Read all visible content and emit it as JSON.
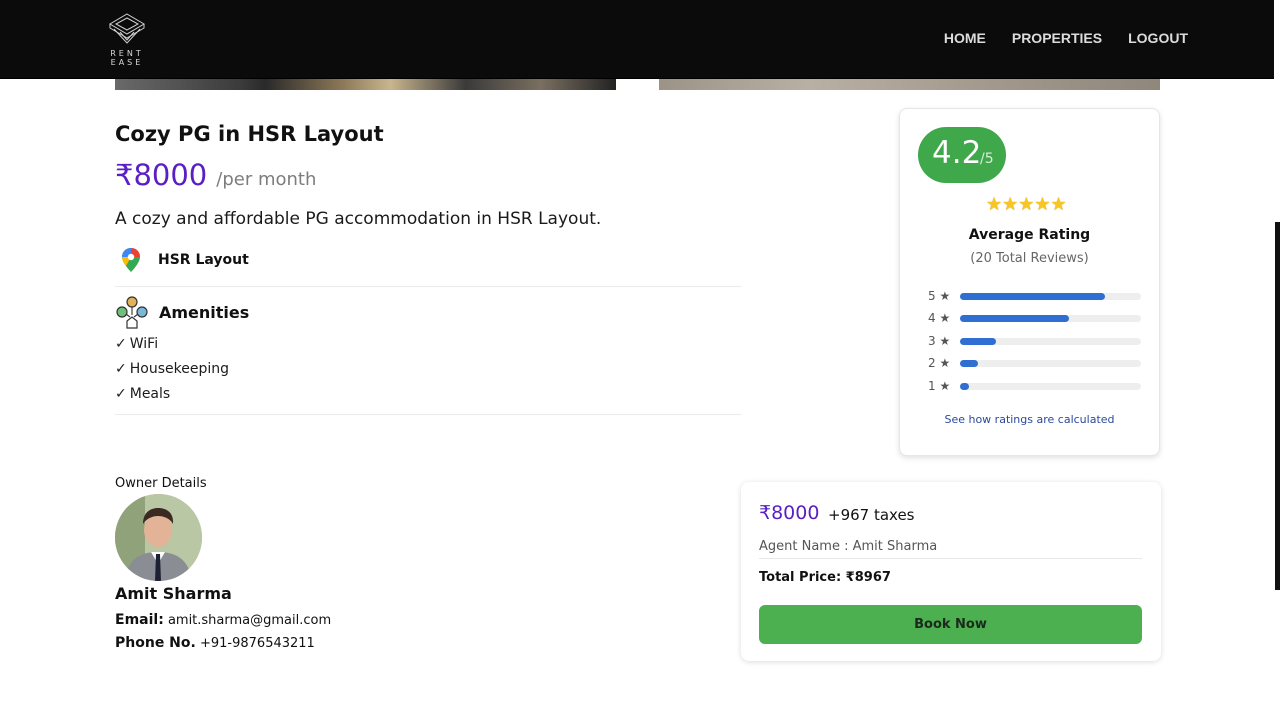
{
  "header": {
    "logo_text": "RENT EASE",
    "nav": [
      "HOME",
      "PROPERTIES",
      "LOGOUT"
    ]
  },
  "listing": {
    "title": "Cozy PG in HSR Layout",
    "price": "₹8000",
    "price_unit": "/per month",
    "description": "A cozy and affordable PG accommodation in HSR Layout.",
    "location": "HSR Layout",
    "amenities_title": "Amenities",
    "amenities": [
      "WiFi",
      "Housekeeping",
      "Meals"
    ],
    "check_mark": "✓"
  },
  "rating": {
    "value": "4.2",
    "max": "/5",
    "stars": "★★★★★",
    "stars_count": 5,
    "label": "Average Rating",
    "total_reviews": "(20 Total Reviews)",
    "breakdown": [
      {
        "label": "5 ★",
        "fraction": 0.8
      },
      {
        "label": "4 ★",
        "fraction": 0.6
      },
      {
        "label": "3 ★",
        "fraction": 0.2
      },
      {
        "label": "2 ★",
        "fraction": 0.1
      },
      {
        "label": "1 ★",
        "fraction": 0.05
      }
    ],
    "link_text": "See how ratings are calculated",
    "pill_color": "#3fa84a",
    "bar_color": "#2f6fd1"
  },
  "owner": {
    "section_label": "Owner Details",
    "name": "Amit Sharma",
    "email_label": "Email:",
    "email": "amit.sharma@gmail.com",
    "phone_label": "Phone No.",
    "phone": "+91-9876543211"
  },
  "booking": {
    "price": "₹8000",
    "taxes": "+967 taxes",
    "agent": "Agent Name : Amit Sharma",
    "total": "Total Price: ₹8967",
    "button_label": "Book Now",
    "button_color": "#4caf50"
  },
  "colors": {
    "accent_purple": "#5a1fc4",
    "header_bg": "#0b0b0b"
  }
}
